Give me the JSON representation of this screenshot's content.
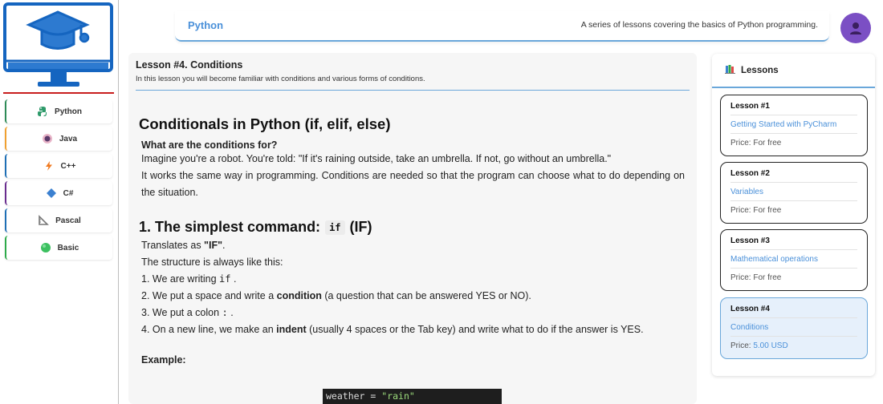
{
  "sidebar": {
    "items": [
      {
        "label": "Python",
        "icon": "python-icon",
        "color": "#2e8b57"
      },
      {
        "label": "Java",
        "icon": "java-icon",
        "color": "#f0a030"
      },
      {
        "label": "C++",
        "icon": "cpp-icon",
        "color": "#1e6fb5"
      },
      {
        "label": "C#",
        "icon": "csharp-icon",
        "color": "#6a2d8f"
      },
      {
        "label": "Pascal",
        "icon": "pascal-icon",
        "color": "#1e6fb5"
      },
      {
        "label": "Basic",
        "icon": "basic-icon",
        "color": "#2eaa4a"
      }
    ]
  },
  "header": {
    "title": "Python",
    "description": "A series of lessons covering the basics of Python programming."
  },
  "lesson": {
    "title": "Lesson #4. Conditions",
    "subtitle": "In this lesson you will become familiar with conditions and various forms of conditions."
  },
  "content": {
    "heading1": "Conditionals in Python (if, elif, else)",
    "question": "What are the conditions for?",
    "para1": "Imagine you're a robot. You're told: \"If it's raining outside, take an umbrella. If not, go without an umbrella.\"",
    "para2": "It works the same way in programming. Conditions are needed so that the program can choose what to do depending on the situation.",
    "heading2_prefix": "1. The simplest command:",
    "heading2_code": "if",
    "heading2_suffix": "(IF)",
    "translates_prefix": "Translates as ",
    "translates_value": "\"IF\"",
    "translates_suffix": ".",
    "structure": "The structure is always like this:",
    "step1_prefix": "1. We are writing ",
    "step1_code": "if",
    "step1_suffix": ".",
    "step2_prefix": "2. We put a space and write a ",
    "step2_bold": "condition",
    "step2_suffix": " (a question that can be answered YES or NO).",
    "step3_prefix": "3. We put a colon ",
    "step3_code": ":",
    "step3_suffix": ".",
    "step4_prefix": "4. On a new line, we make an ",
    "step4_bold": "indent",
    "step4_suffix": " (usually 4 spaces or the Tab key) and write what to do if the answer is YES.",
    "example_label": "Example:",
    "code_var": "weather = ",
    "code_str": "\"rain\""
  },
  "panel": {
    "title": "Lessons",
    "cards": [
      {
        "title": "Lesson #1",
        "link": "Getting Started with PyCharm",
        "price_label": "Price: ",
        "price_value": "For free"
      },
      {
        "title": "Lesson #2",
        "link": "Variables",
        "price_label": "Price: ",
        "price_value": "For free"
      },
      {
        "title": "Lesson #3",
        "link": "Mathematical operations",
        "price_label": "Price: ",
        "price_value": "For free"
      },
      {
        "title": "Lesson #4",
        "link": "Conditions",
        "price_label": "Price: ",
        "price_value": "5.00 USD",
        "active": true
      }
    ]
  },
  "colors": {
    "accent": "#4a90d9",
    "logo_blue": "#1565c0",
    "logo_red": "#c81e1e",
    "avatar": "#7b4fc4"
  }
}
